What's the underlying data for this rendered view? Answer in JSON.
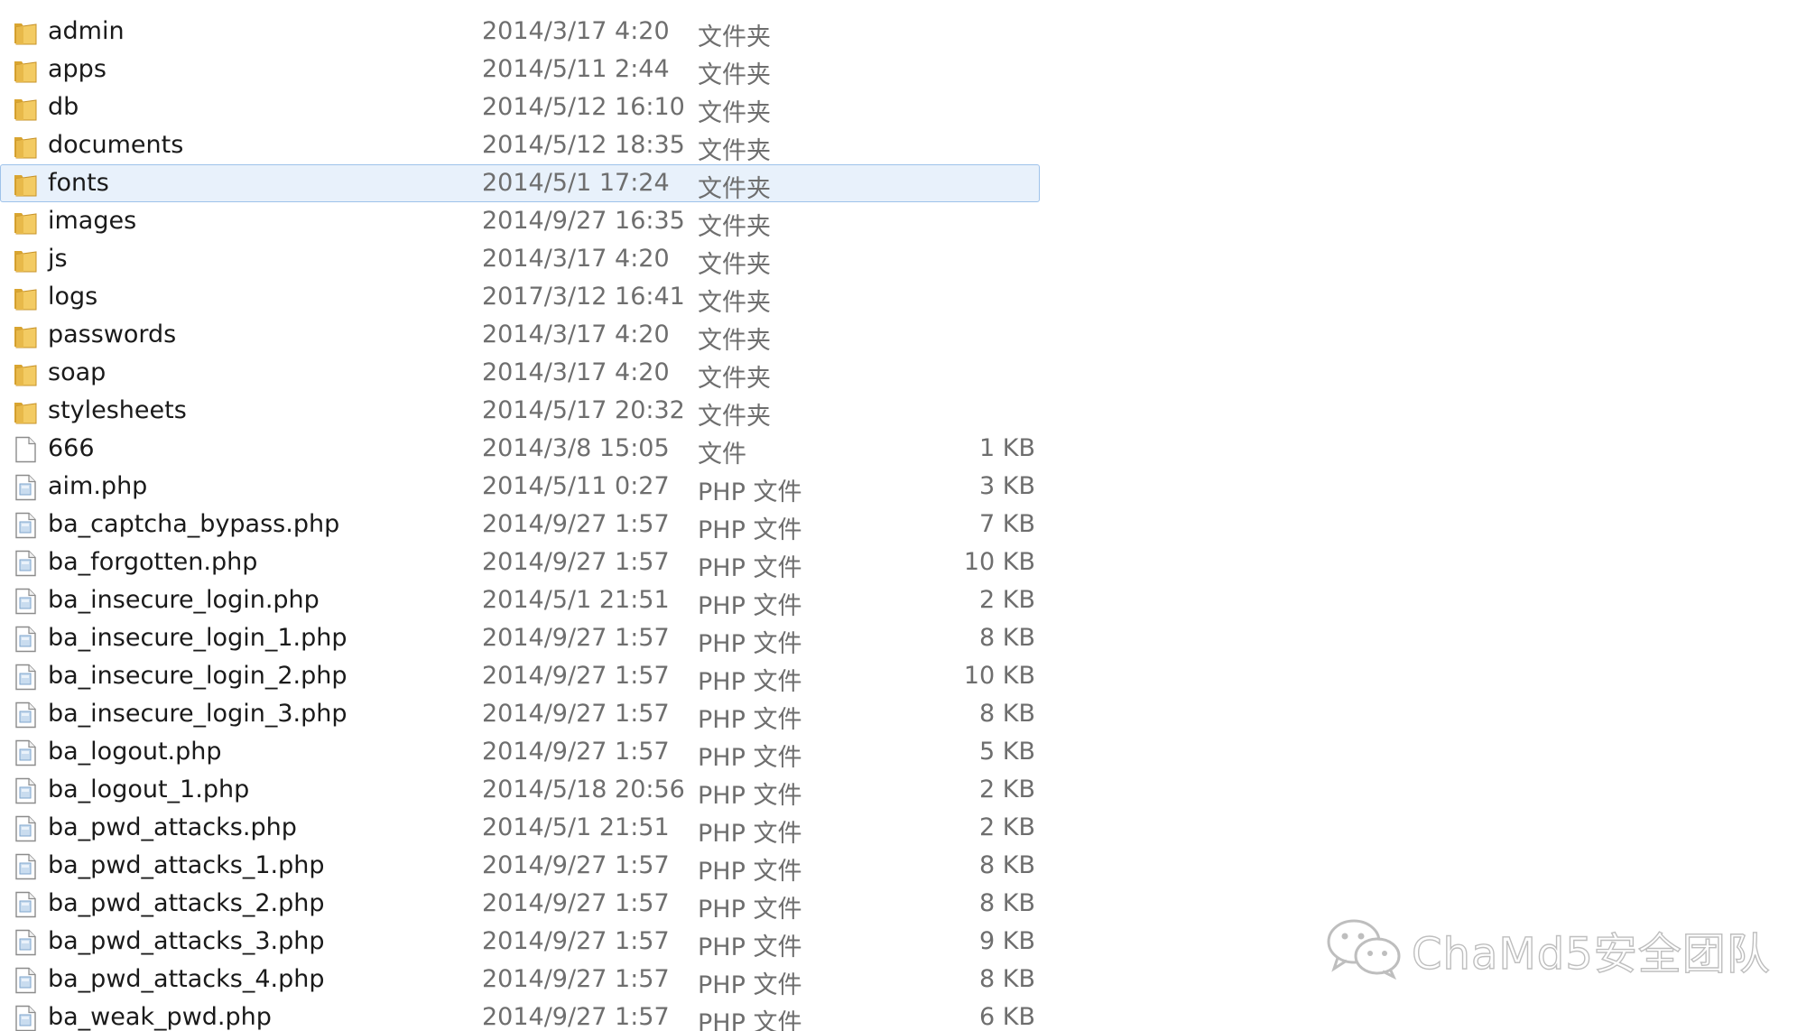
{
  "files": [
    {
      "name": "admin",
      "date": "2014/3/17 4:20",
      "type": "文件夹",
      "size": "",
      "kind": "folder-icon"
    },
    {
      "name": "apps",
      "date": "2014/5/11 2:44",
      "type": "文件夹",
      "size": "",
      "kind": "folder-icon"
    },
    {
      "name": "db",
      "date": "2014/5/12 16:10",
      "type": "文件夹",
      "size": "",
      "kind": "folder-icon"
    },
    {
      "name": "documents",
      "date": "2014/5/12 18:35",
      "type": "文件夹",
      "size": "",
      "kind": "folder-icon"
    },
    {
      "name": "fonts",
      "date": "2014/5/1 17:24",
      "type": "文件夹",
      "size": "",
      "kind": "folder-icon",
      "selected": true
    },
    {
      "name": "images",
      "date": "2014/9/27 16:35",
      "type": "文件夹",
      "size": "",
      "kind": "folder-icon"
    },
    {
      "name": "js",
      "date": "2014/3/17 4:20",
      "type": "文件夹",
      "size": "",
      "kind": "folder-icon"
    },
    {
      "name": "logs",
      "date": "2017/3/12 16:41",
      "type": "文件夹",
      "size": "",
      "kind": "folder-icon"
    },
    {
      "name": "passwords",
      "date": "2014/3/17 4:20",
      "type": "文件夹",
      "size": "",
      "kind": "folder-icon"
    },
    {
      "name": "soap",
      "date": "2014/3/17 4:20",
      "type": "文件夹",
      "size": "",
      "kind": "folder-icon"
    },
    {
      "name": "stylesheets",
      "date": "2014/5/17 20:32",
      "type": "文件夹",
      "size": "",
      "kind": "folder-icon"
    },
    {
      "name": "666",
      "date": "2014/3/8 15:05",
      "type": "文件",
      "size": "1 KB",
      "kind": "blank-file-icon"
    },
    {
      "name": "aim.php",
      "date": "2014/5/11 0:27",
      "type": "PHP 文件",
      "size": "3 KB",
      "kind": "php-file-icon"
    },
    {
      "name": "ba_captcha_bypass.php",
      "date": "2014/9/27 1:57",
      "type": "PHP 文件",
      "size": "7 KB",
      "kind": "php-file-icon"
    },
    {
      "name": "ba_forgotten.php",
      "date": "2014/9/27 1:57",
      "type": "PHP 文件",
      "size": "10 KB",
      "kind": "php-file-icon"
    },
    {
      "name": "ba_insecure_login.php",
      "date": "2014/5/1 21:51",
      "type": "PHP 文件",
      "size": "2 KB",
      "kind": "php-file-icon"
    },
    {
      "name": "ba_insecure_login_1.php",
      "date": "2014/9/27 1:57",
      "type": "PHP 文件",
      "size": "8 KB",
      "kind": "php-file-icon"
    },
    {
      "name": "ba_insecure_login_2.php",
      "date": "2014/9/27 1:57",
      "type": "PHP 文件",
      "size": "10 KB",
      "kind": "php-file-icon"
    },
    {
      "name": "ba_insecure_login_3.php",
      "date": "2014/9/27 1:57",
      "type": "PHP 文件",
      "size": "8 KB",
      "kind": "php-file-icon"
    },
    {
      "name": "ba_logout.php",
      "date": "2014/9/27 1:57",
      "type": "PHP 文件",
      "size": "5 KB",
      "kind": "php-file-icon"
    },
    {
      "name": "ba_logout_1.php",
      "date": "2014/5/18 20:56",
      "type": "PHP 文件",
      "size": "2 KB",
      "kind": "php-file-icon"
    },
    {
      "name": "ba_pwd_attacks.php",
      "date": "2014/5/1 21:51",
      "type": "PHP 文件",
      "size": "2 KB",
      "kind": "php-file-icon"
    },
    {
      "name": "ba_pwd_attacks_1.php",
      "date": "2014/9/27 1:57",
      "type": "PHP 文件",
      "size": "8 KB",
      "kind": "php-file-icon"
    },
    {
      "name": "ba_pwd_attacks_2.php",
      "date": "2014/9/27 1:57",
      "type": "PHP 文件",
      "size": "8 KB",
      "kind": "php-file-icon"
    },
    {
      "name": "ba_pwd_attacks_3.php",
      "date": "2014/9/27 1:57",
      "type": "PHP 文件",
      "size": "9 KB",
      "kind": "php-file-icon"
    },
    {
      "name": "ba_pwd_attacks_4.php",
      "date": "2014/9/27 1:57",
      "type": "PHP 文件",
      "size": "8 KB",
      "kind": "php-file-icon"
    },
    {
      "name": "ba_weak_pwd.php",
      "date": "2014/9/27 1:57",
      "type": "PHP 文件",
      "size": "6 KB",
      "kind": "php-file-icon"
    }
  ],
  "watermark": {
    "text": "ChaMd5安全团队",
    "icon": "wechat-icon"
  },
  "colors": {
    "selection_bg": "#e8f1fb",
    "selection_border": "#9ec2ea",
    "folder": "#e8b94a",
    "meta_text": "#6e6e6e"
  }
}
